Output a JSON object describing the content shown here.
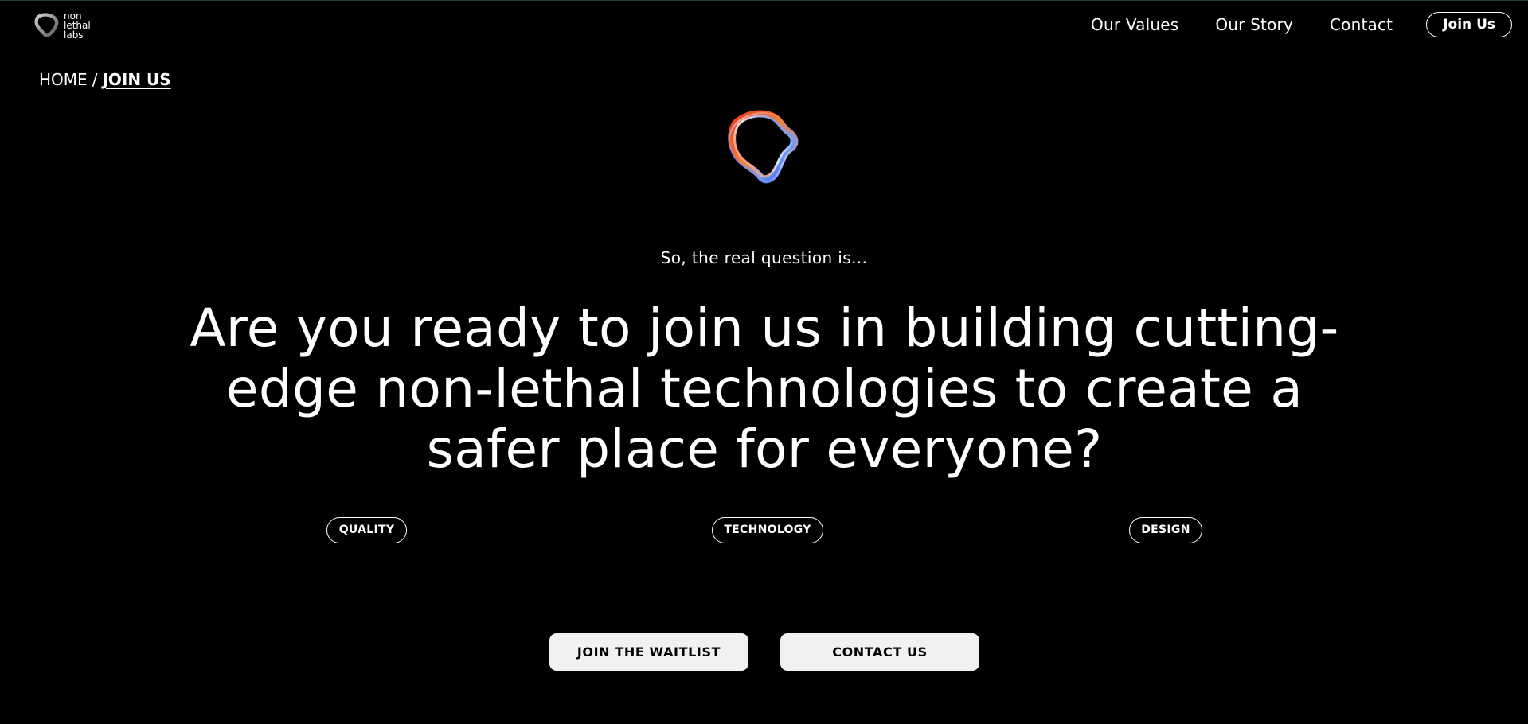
{
  "header": {
    "logo_lines": [
      "non",
      "lethal",
      "labs"
    ],
    "nav": [
      {
        "label": "Our Values"
      },
      {
        "label": "Our Story"
      },
      {
        "label": "Contact"
      }
    ],
    "join_label": "Join Us"
  },
  "breadcrumb": {
    "home": "HOME",
    "separator": "/",
    "current": "JOIN US"
  },
  "hero": {
    "eyebrow": "So, the real question is...",
    "headline": "Are you ready to join us in building cutting-edge non-lethal technologies to create a safer place for everyone?"
  },
  "tags": [
    "QUALITY",
    "TECHNOLOGY",
    "DESIGN"
  ],
  "cta": {
    "waitlist": "JOIN THE WAITLIST",
    "contact": "CONTACT US"
  },
  "colors": {
    "background": "#000000",
    "text": "#ffffff",
    "button_bg": "#f1f1f1",
    "button_text": "#000000",
    "ring_orange": "#ff5a1f",
    "ring_blue": "#2f6bff"
  }
}
